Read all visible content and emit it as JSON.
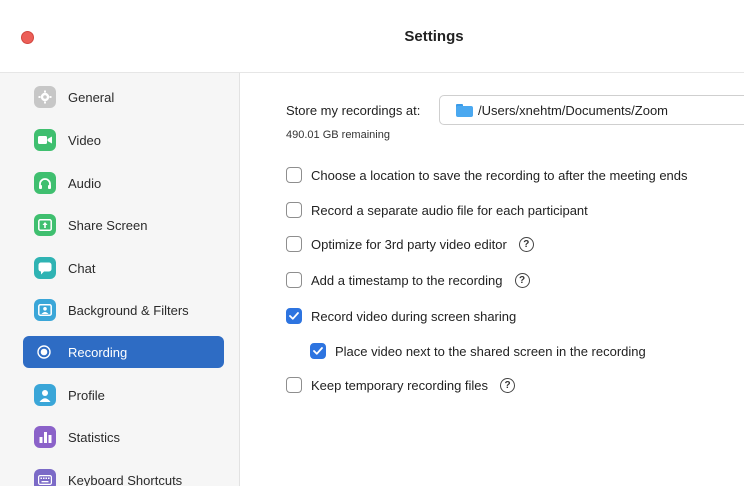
{
  "window": {
    "title": "Settings"
  },
  "sidebar": {
    "items": [
      {
        "label": "General",
        "icon": "gear-icon",
        "color": "#c7c7c7",
        "active": false
      },
      {
        "label": "Video",
        "icon": "video-camera-icon",
        "color": "#3fbf6f",
        "active": false
      },
      {
        "label": "Audio",
        "icon": "headphones-icon",
        "color": "#3fbf6f",
        "active": false
      },
      {
        "label": "Share Screen",
        "icon": "share-screen-icon",
        "color": "#3fbf6f",
        "active": false
      },
      {
        "label": "Chat",
        "icon": "chat-bubble-icon",
        "color": "#2fb3b3",
        "active": false
      },
      {
        "label": "Background & Filters",
        "icon": "background-person-icon",
        "color": "#3aa6d8",
        "active": false
      },
      {
        "label": "Recording",
        "icon": "record-icon",
        "color": "#2e6cc4",
        "active": true
      },
      {
        "label": "Profile",
        "icon": "profile-person-icon",
        "color": "#3aa6d8",
        "active": false
      },
      {
        "label": "Statistics",
        "icon": "bar-chart-icon",
        "color": "#8b62c9",
        "active": false
      },
      {
        "label": "Keyboard Shortcuts",
        "icon": "keyboard-icon",
        "color": "#7b6ac7",
        "active": false
      }
    ]
  },
  "recording": {
    "store_label": "Store my recordings at:",
    "path": "/Users/xnehtm/Documents/Zoom",
    "remaining": "490.01 GB remaining",
    "options": [
      {
        "label": "Choose a location to save the recording to after the meeting ends",
        "checked": false,
        "help": false
      },
      {
        "label": "Record a separate audio file for each participant",
        "checked": false,
        "help": false
      },
      {
        "label": "Optimize for 3rd party video editor",
        "checked": false,
        "help": true
      },
      {
        "label": "Add a timestamp to the recording",
        "checked": false,
        "help": true
      },
      {
        "label": "Record video during screen sharing",
        "checked": true,
        "help": false
      },
      {
        "label": "Place video next to the shared screen in the recording",
        "checked": true,
        "help": false
      },
      {
        "label": "Keep temporary recording files",
        "checked": false,
        "help": true
      }
    ],
    "help_glyph": "?"
  },
  "colors": {
    "accent": "#2e6cc4",
    "checkbox_checked": "#2d74e0",
    "close_button": "#ec5f58"
  }
}
